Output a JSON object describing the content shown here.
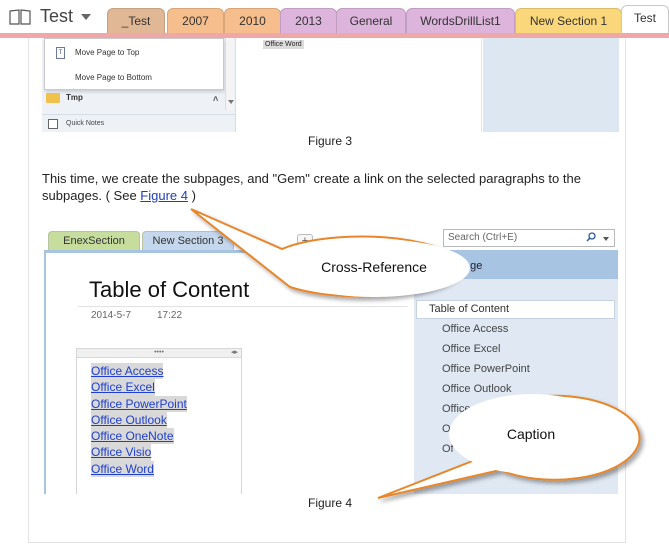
{
  "notebook": {
    "title": "Test",
    "sections": [
      {
        "label": "_Test",
        "color": "#e1b896"
      },
      {
        "label": "2007",
        "color": "#f5be8c"
      },
      {
        "label": "2010",
        "color": "#f5be8c"
      },
      {
        "label": "2013",
        "color": "#dcb4dc"
      },
      {
        "label": "General",
        "color": "#dcb4dc"
      },
      {
        "label": "WordsDrillList1",
        "color": "#dcb4dc"
      },
      {
        "label": "New Section 1",
        "color": "#fad77a"
      },
      {
        "label": "Test",
        "color": "#ffffff"
      }
    ],
    "section_color": "#f0a7a7"
  },
  "figure3": {
    "menu": {
      "items": [
        {
          "label": "Move Page to Top",
          "icon": "page-icon"
        },
        {
          "label": "Move Page to Bottom"
        }
      ]
    },
    "section_row": {
      "label": "Tmp",
      "icon": "folder-icon"
    },
    "quick_notes": "Quick Notes",
    "chip": "Office Word",
    "caption": "Figure 3"
  },
  "paragraph": {
    "before": "This time, we create the subpages, and \"Gem\" create a link on the selected paragraphs to the subpages. ( See ",
    "link": "Figure 4",
    "after": " )"
  },
  "figure4": {
    "tabs": [
      {
        "label": "EnexSection",
        "color": "#c6dd9e"
      },
      {
        "label": "New Section 3",
        "color": "#c4d7ec"
      }
    ],
    "plus": "+",
    "search_placeholder": "Search (Ctrl+E)",
    "add_page": "age",
    "page_title": "Table of Content",
    "date": "2014-5-7",
    "time": "17:22",
    "links": [
      "Office Access",
      "Office Excel",
      "Office PowerPoint",
      "Office Outlook",
      "Office OneNote",
      "Office Visio",
      "Office Word"
    ],
    "toc_item": "Table of Content",
    "subpages": [
      "Office Access",
      "Office Excel",
      "Office PowerPoint",
      "Office Outlook",
      "Office O",
      "O",
      "Of"
    ],
    "caption": "Figure 4"
  },
  "callouts": {
    "cross_reference": "Cross-Reference",
    "caption_label": "Caption"
  }
}
